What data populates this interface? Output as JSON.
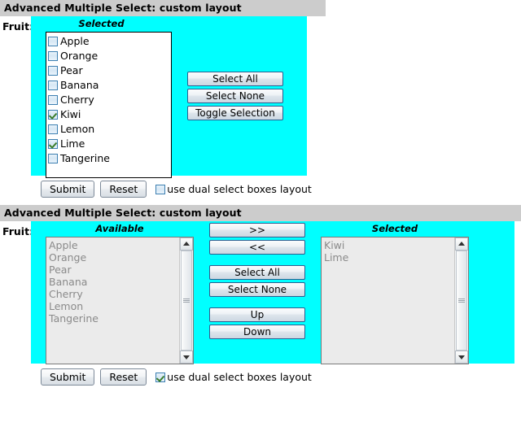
{
  "theme": {
    "panel_bg": "#00ffff",
    "header_bg": "#cccccc",
    "listbox_bg": "#ebebeb",
    "list_text": "#8a8a8a",
    "check_color": "#3a7d2c"
  },
  "panel1": {
    "header_title": "Advanced Multiple Select: custom layout",
    "field_label": "Fruit:",
    "column_title": "Selected",
    "checkbox_items": [
      {
        "label": "Apple",
        "checked": false
      },
      {
        "label": "Orange",
        "checked": false
      },
      {
        "label": "Pear",
        "checked": false
      },
      {
        "label": "Banana",
        "checked": false
      },
      {
        "label": "Cherry",
        "checked": false
      },
      {
        "label": "Kiwi",
        "checked": true
      },
      {
        "label": "Lemon",
        "checked": false
      },
      {
        "label": "Lime",
        "checked": true
      },
      {
        "label": "Tangerine",
        "checked": false
      }
    ],
    "side_buttons": [
      {
        "label": "Select All"
      },
      {
        "label": "Select None"
      },
      {
        "label": "Toggle Selection"
      }
    ],
    "actions": {
      "submit_label": "Submit",
      "reset_label": "Reset",
      "dual_layout_label": "use dual select boxes layout",
      "dual_layout_checked": false
    }
  },
  "panel2": {
    "header_title": "Advanced Multiple Select: custom layout",
    "field_label": "Fruit:",
    "available_title": "Available",
    "selected_title": "Selected",
    "available_items": [
      "Apple",
      "Orange",
      "Pear",
      "Banana",
      "Cherry",
      "Lemon",
      "Tangerine"
    ],
    "selected_items": [
      "Kiwi",
      "Lime"
    ],
    "transfer_buttons": [
      {
        "label": ">>"
      },
      {
        "label": "<<"
      }
    ],
    "select_buttons": [
      {
        "label": "Select All"
      },
      {
        "label": "Select None"
      }
    ],
    "order_buttons": [
      {
        "label": "Up"
      },
      {
        "label": "Down"
      }
    ],
    "actions": {
      "submit_label": "Submit",
      "reset_label": "Reset",
      "dual_layout_label": "use dual select boxes layout",
      "dual_layout_checked": true
    }
  }
}
